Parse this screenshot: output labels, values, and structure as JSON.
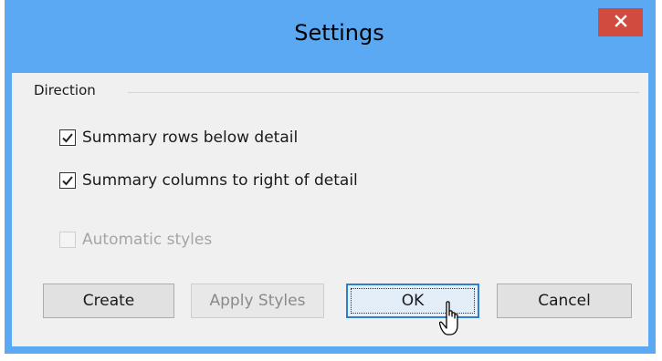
{
  "window": {
    "title": "Settings",
    "close_icon": "close-icon",
    "colors": {
      "titlebar": "#5aa9f2",
      "close_button": "#d24b3f",
      "client": "#f0f0f0"
    }
  },
  "group": {
    "label": "Direction"
  },
  "options": [
    {
      "label": "Summary rows below detail",
      "checked": true,
      "enabled": true
    },
    {
      "label": "Summary columns to right of detail",
      "checked": true,
      "enabled": true
    },
    {
      "label": "Automatic styles",
      "checked": false,
      "enabled": false
    }
  ],
  "buttons": {
    "create": "Create",
    "apply_styles": "Apply Styles",
    "ok": "OK",
    "cancel": "Cancel"
  }
}
